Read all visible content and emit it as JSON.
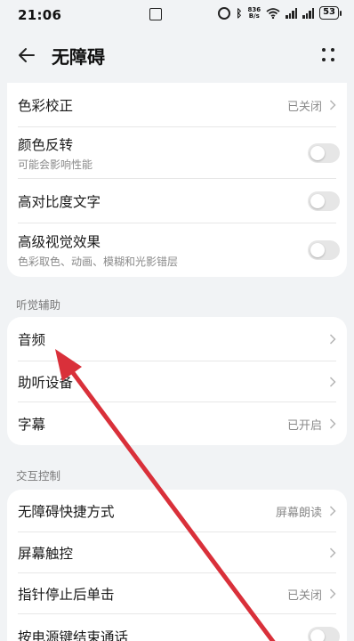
{
  "status_bar": {
    "time": "21:06",
    "speed_top": "836",
    "speed_bottom": "B/s",
    "battery": "53"
  },
  "header": {
    "title": "无障碍"
  },
  "vision_card": [
    {
      "label": "色彩校正",
      "value": "已关闭",
      "type": "link"
    },
    {
      "label": "颜色反转",
      "sub": "可能会影响性能",
      "type": "toggle",
      "on": false
    },
    {
      "label": "高对比度文字",
      "type": "toggle",
      "on": false
    },
    {
      "label": "高级视觉效果",
      "sub": "色彩取色、动画、模糊和光影错层",
      "type": "toggle",
      "on": false
    }
  ],
  "hearing": {
    "section_title": "听觉辅助",
    "items": [
      {
        "label": "音频",
        "type": "link"
      },
      {
        "label": "助听设备",
        "type": "link"
      },
      {
        "label": "字幕",
        "value": "已开启",
        "type": "link"
      }
    ]
  },
  "interaction": {
    "section_title": "交互控制",
    "items": [
      {
        "label": "无障碍快捷方式",
        "value": "屏幕朗读",
        "type": "link"
      },
      {
        "label": "屏幕触控",
        "type": "link"
      },
      {
        "label": "指针停止后单击",
        "value": "已关闭",
        "type": "link"
      },
      {
        "label": "按电源键结束通话",
        "type": "toggle",
        "on": false
      }
    ]
  },
  "colors": {
    "accent_arrow": "#d9303a",
    "background": "#f1f3f5"
  }
}
